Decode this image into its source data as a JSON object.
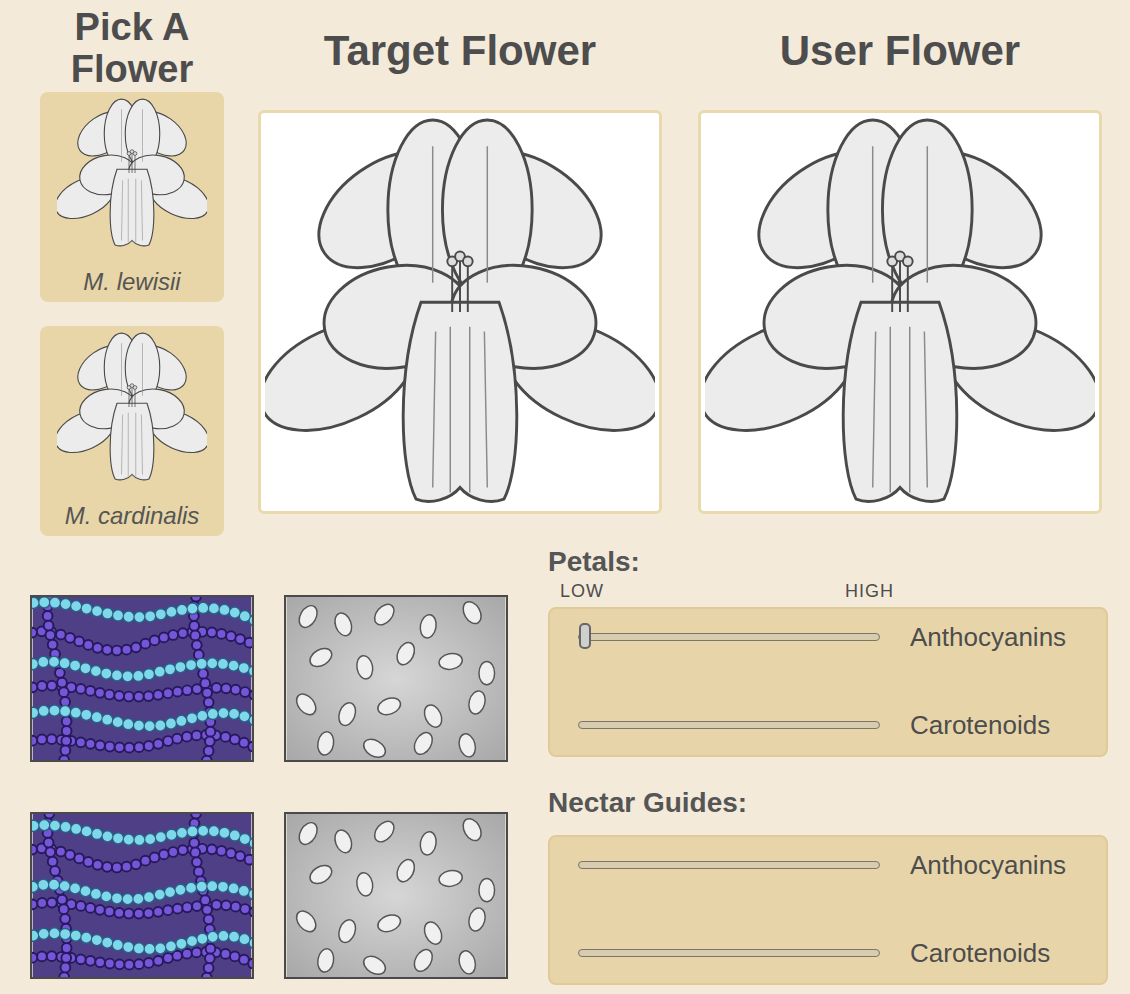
{
  "picker": {
    "title": "Pick A Flower",
    "flowers": [
      {
        "name": "M. lewisii",
        "selected": false
      },
      {
        "name": "M. cardinalis",
        "selected": false
      }
    ]
  },
  "panels": [
    {
      "title": "Target Flower"
    },
    {
      "title": "User Flower"
    }
  ],
  "controls": [
    {
      "title": "Petals:",
      "scale": {
        "low": "LOW",
        "high": "HIGH"
      },
      "sliders": [
        {
          "label": "Anthocyanins",
          "level": 0,
          "set": true
        },
        {
          "label": "Carotenoids",
          "level": 0,
          "set": false
        }
      ]
    },
    {
      "title": "Nectar Guides:",
      "sliders": [
        {
          "label": "Anthocyanins",
          "level": 0,
          "set": false
        },
        {
          "label": "Carotenoids",
          "level": 0,
          "set": false
        }
      ]
    }
  ]
}
